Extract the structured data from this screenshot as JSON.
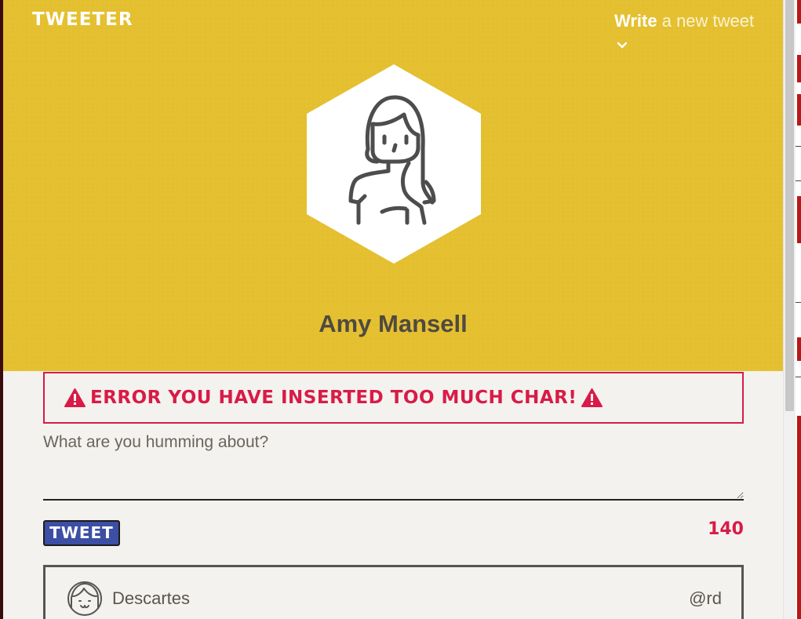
{
  "app": {
    "brand": "TWEETER"
  },
  "header": {
    "write_bold": "Write",
    "write_rest": " a new tweet",
    "chevron_icon": "chevron-down-icon",
    "avatar_icon": "woman-avatar-icon"
  },
  "profile": {
    "name": "Amy Mansell"
  },
  "error": {
    "icon": "warning-icon",
    "message": "ERROR YOU HAVE INSERTED TOO MUCH CHAR!"
  },
  "composer": {
    "placeholder": "What are you humming about?",
    "value": "",
    "submit_label": "TWEET",
    "char_count": "140"
  },
  "feed": {
    "tweets": [
      {
        "name": "Descartes",
        "handle": "@rd",
        "avatar_icon": "girl-avatar-icon"
      }
    ]
  },
  "colors": {
    "header_bg": "#e4bf2f",
    "error_red": "#d81b47",
    "button_blue": "#3c4fa5",
    "page_bg": "#f4f2ee",
    "text_dark": "#4f4a40"
  }
}
